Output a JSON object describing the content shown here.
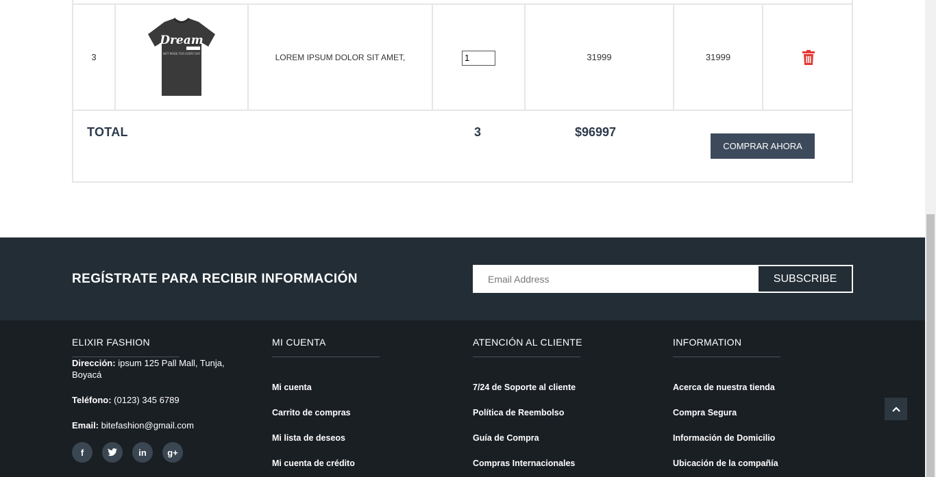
{
  "cart": {
    "row": {
      "number": "3",
      "product_image": "t-shirt-dream",
      "description": "LOREM IPSUM DOLOR SIT AMET,",
      "quantity": "1",
      "price": "31999",
      "subtotal": "31999",
      "delete_icon": "trash-icon"
    },
    "total_label": "TOTAL",
    "total_quantity": "3",
    "total_amount": "$96997",
    "buy_button": "COMPRAR AHORA"
  },
  "newsletter": {
    "title": "REGÍSTRATE PARA RECIBIR INFORMACIÓN",
    "email_placeholder": "Email Address",
    "subscribe_button": "SUBSCRIBE"
  },
  "footer": {
    "brand": {
      "title": "ELIXIR FASHION",
      "address_label": "Dirección:",
      "address": "ipsum 125 Pall Mall, Tunja, Boyacá",
      "phone_label": "Teléfono:",
      "phone": "(0123) 345 6789",
      "email_label": "Email:",
      "email": "bitefashion@gmail.com",
      "socials": [
        "facebook-icon",
        "twitter-icon",
        "linkedin-icon",
        "google-plus-icon"
      ]
    },
    "account": {
      "title": "MI CUENTA",
      "items": [
        "Mi cuenta",
        "Carrito de compras",
        "Mi lista de deseos",
        "Mi cuenta de crédito"
      ]
    },
    "support": {
      "title": "ATENCIÓN AL CLIENTE",
      "items": [
        "7/24 de Soporte al cliente",
        "Política de Reembolso",
        "Guía de Compra",
        "Compras Internacionales"
      ]
    },
    "information": {
      "title": "INFORMATION",
      "items": [
        "Acerca de nuestra tienda",
        "Compra Segura",
        "Información de Domicilio",
        "Ubicación de la compañía"
      ]
    }
  },
  "colors": {
    "primary_dark": "#222d35",
    "footer_bg": "#1a1f24",
    "button": "#3d4a5b",
    "danger": "#e53935"
  }
}
